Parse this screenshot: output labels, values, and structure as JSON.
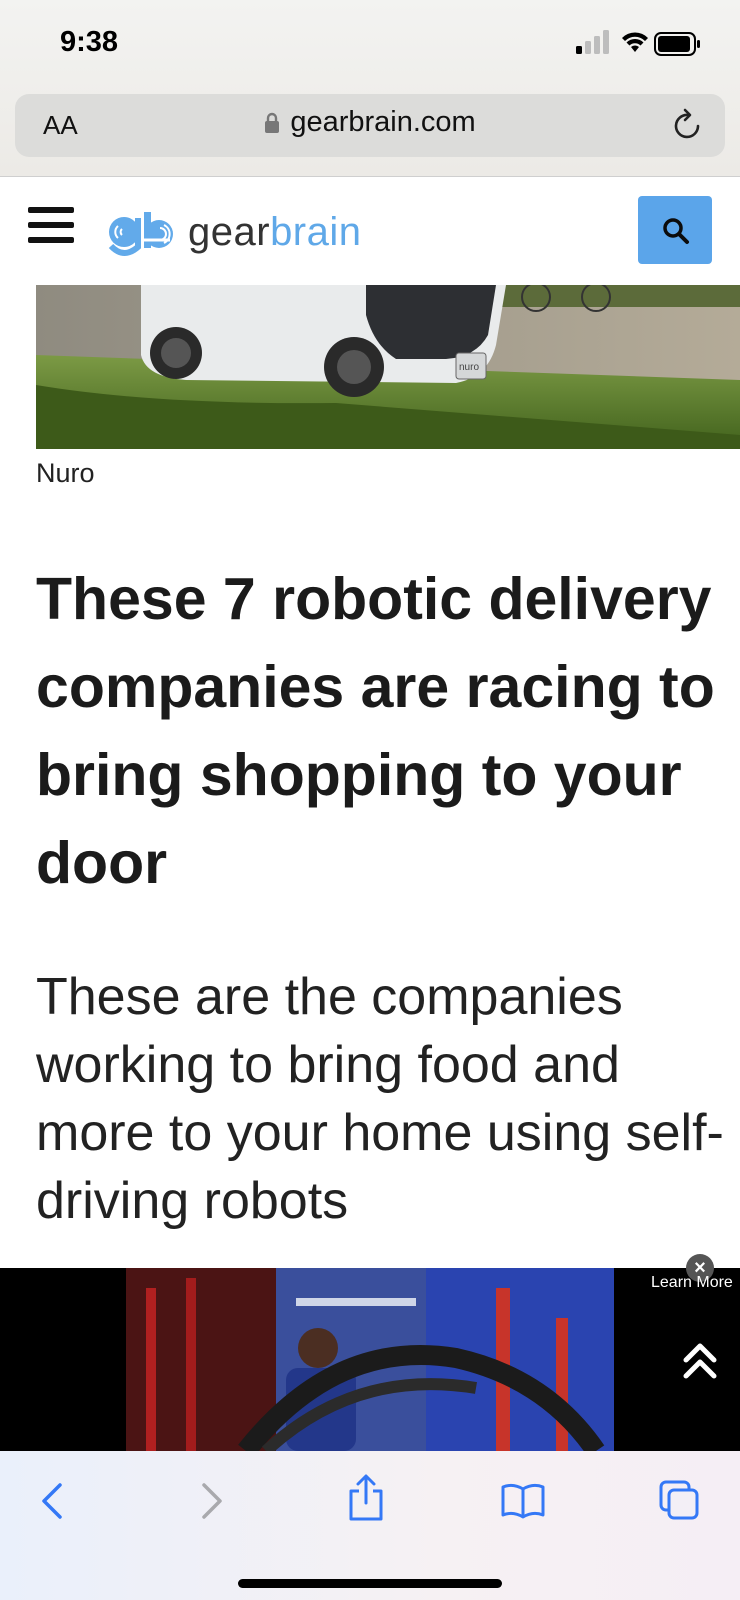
{
  "status_bar": {
    "time": "9:38"
  },
  "browser": {
    "text_size_label": "AA",
    "url": "gearbrain.com"
  },
  "site": {
    "logo_mark": "gb",
    "logo_text_dark": "gear",
    "logo_text_light": "brain"
  },
  "article": {
    "image_caption": "Nuro",
    "van_badge": "nuro",
    "headline": [
      "These 7 robotic delivery",
      "companies are racing to",
      "bring shopping to your",
      "door"
    ],
    "subheadline": "These are the companies working to bring food and more to your home using self-driving robots"
  },
  "ad": {
    "close_label": "×",
    "learn_more": "Learn More"
  },
  "colors": {
    "accent": "#5ba5ea",
    "safari_blue": "#3478f6"
  }
}
